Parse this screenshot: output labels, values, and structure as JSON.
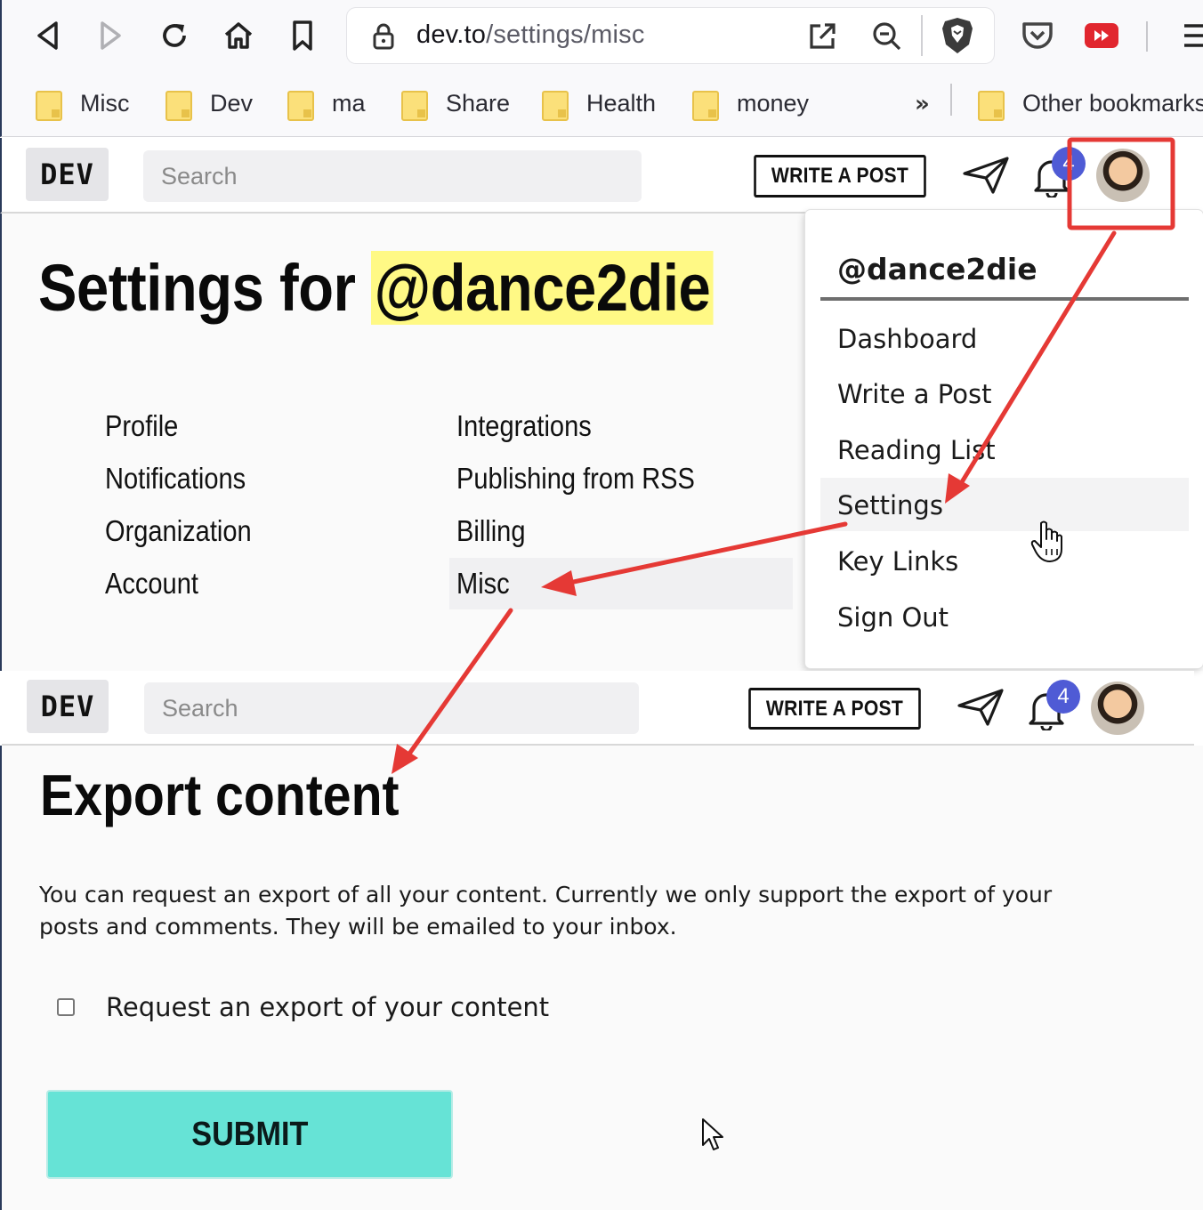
{
  "browser": {
    "url_host": "dev.to",
    "url_path": "/settings/misc",
    "bookmarks": [
      "Misc",
      "Dev",
      "ma",
      "Share",
      "Health",
      "money"
    ],
    "bookmarks_overflow": "»",
    "other_bookmarks": "Other bookmarks"
  },
  "header": {
    "logo": "DEV",
    "search_placeholder": "Search",
    "write_post": "WRITE A POST",
    "notification_count": "4"
  },
  "settings": {
    "title_prefix": "Settings for ",
    "title_username": "@dance2die",
    "nav_left": [
      "Profile",
      "Notifications",
      "Organization",
      "Account"
    ],
    "nav_right": [
      "Integrations",
      "Publishing from RSS",
      "Billing",
      "Misc"
    ]
  },
  "dropdown": {
    "username": "@dance2die",
    "items": [
      "Dashboard",
      "Write a Post",
      "Reading List",
      "Settings",
      "Key Links",
      "Sign Out"
    ]
  },
  "export": {
    "title": "Export content",
    "description": "You can request an export of all your content. Currently we only support the export of your posts and comments. They will be emailed to your inbox.",
    "checkbox_label": "Request an export of your content",
    "checkbox_checked": false,
    "submit": "SUBMIT"
  },
  "colors": {
    "annotation_red": "#e53935",
    "badge_blue": "#4f5bd5",
    "submit_teal": "#66e3d6",
    "username_highlight": "#fff985"
  }
}
